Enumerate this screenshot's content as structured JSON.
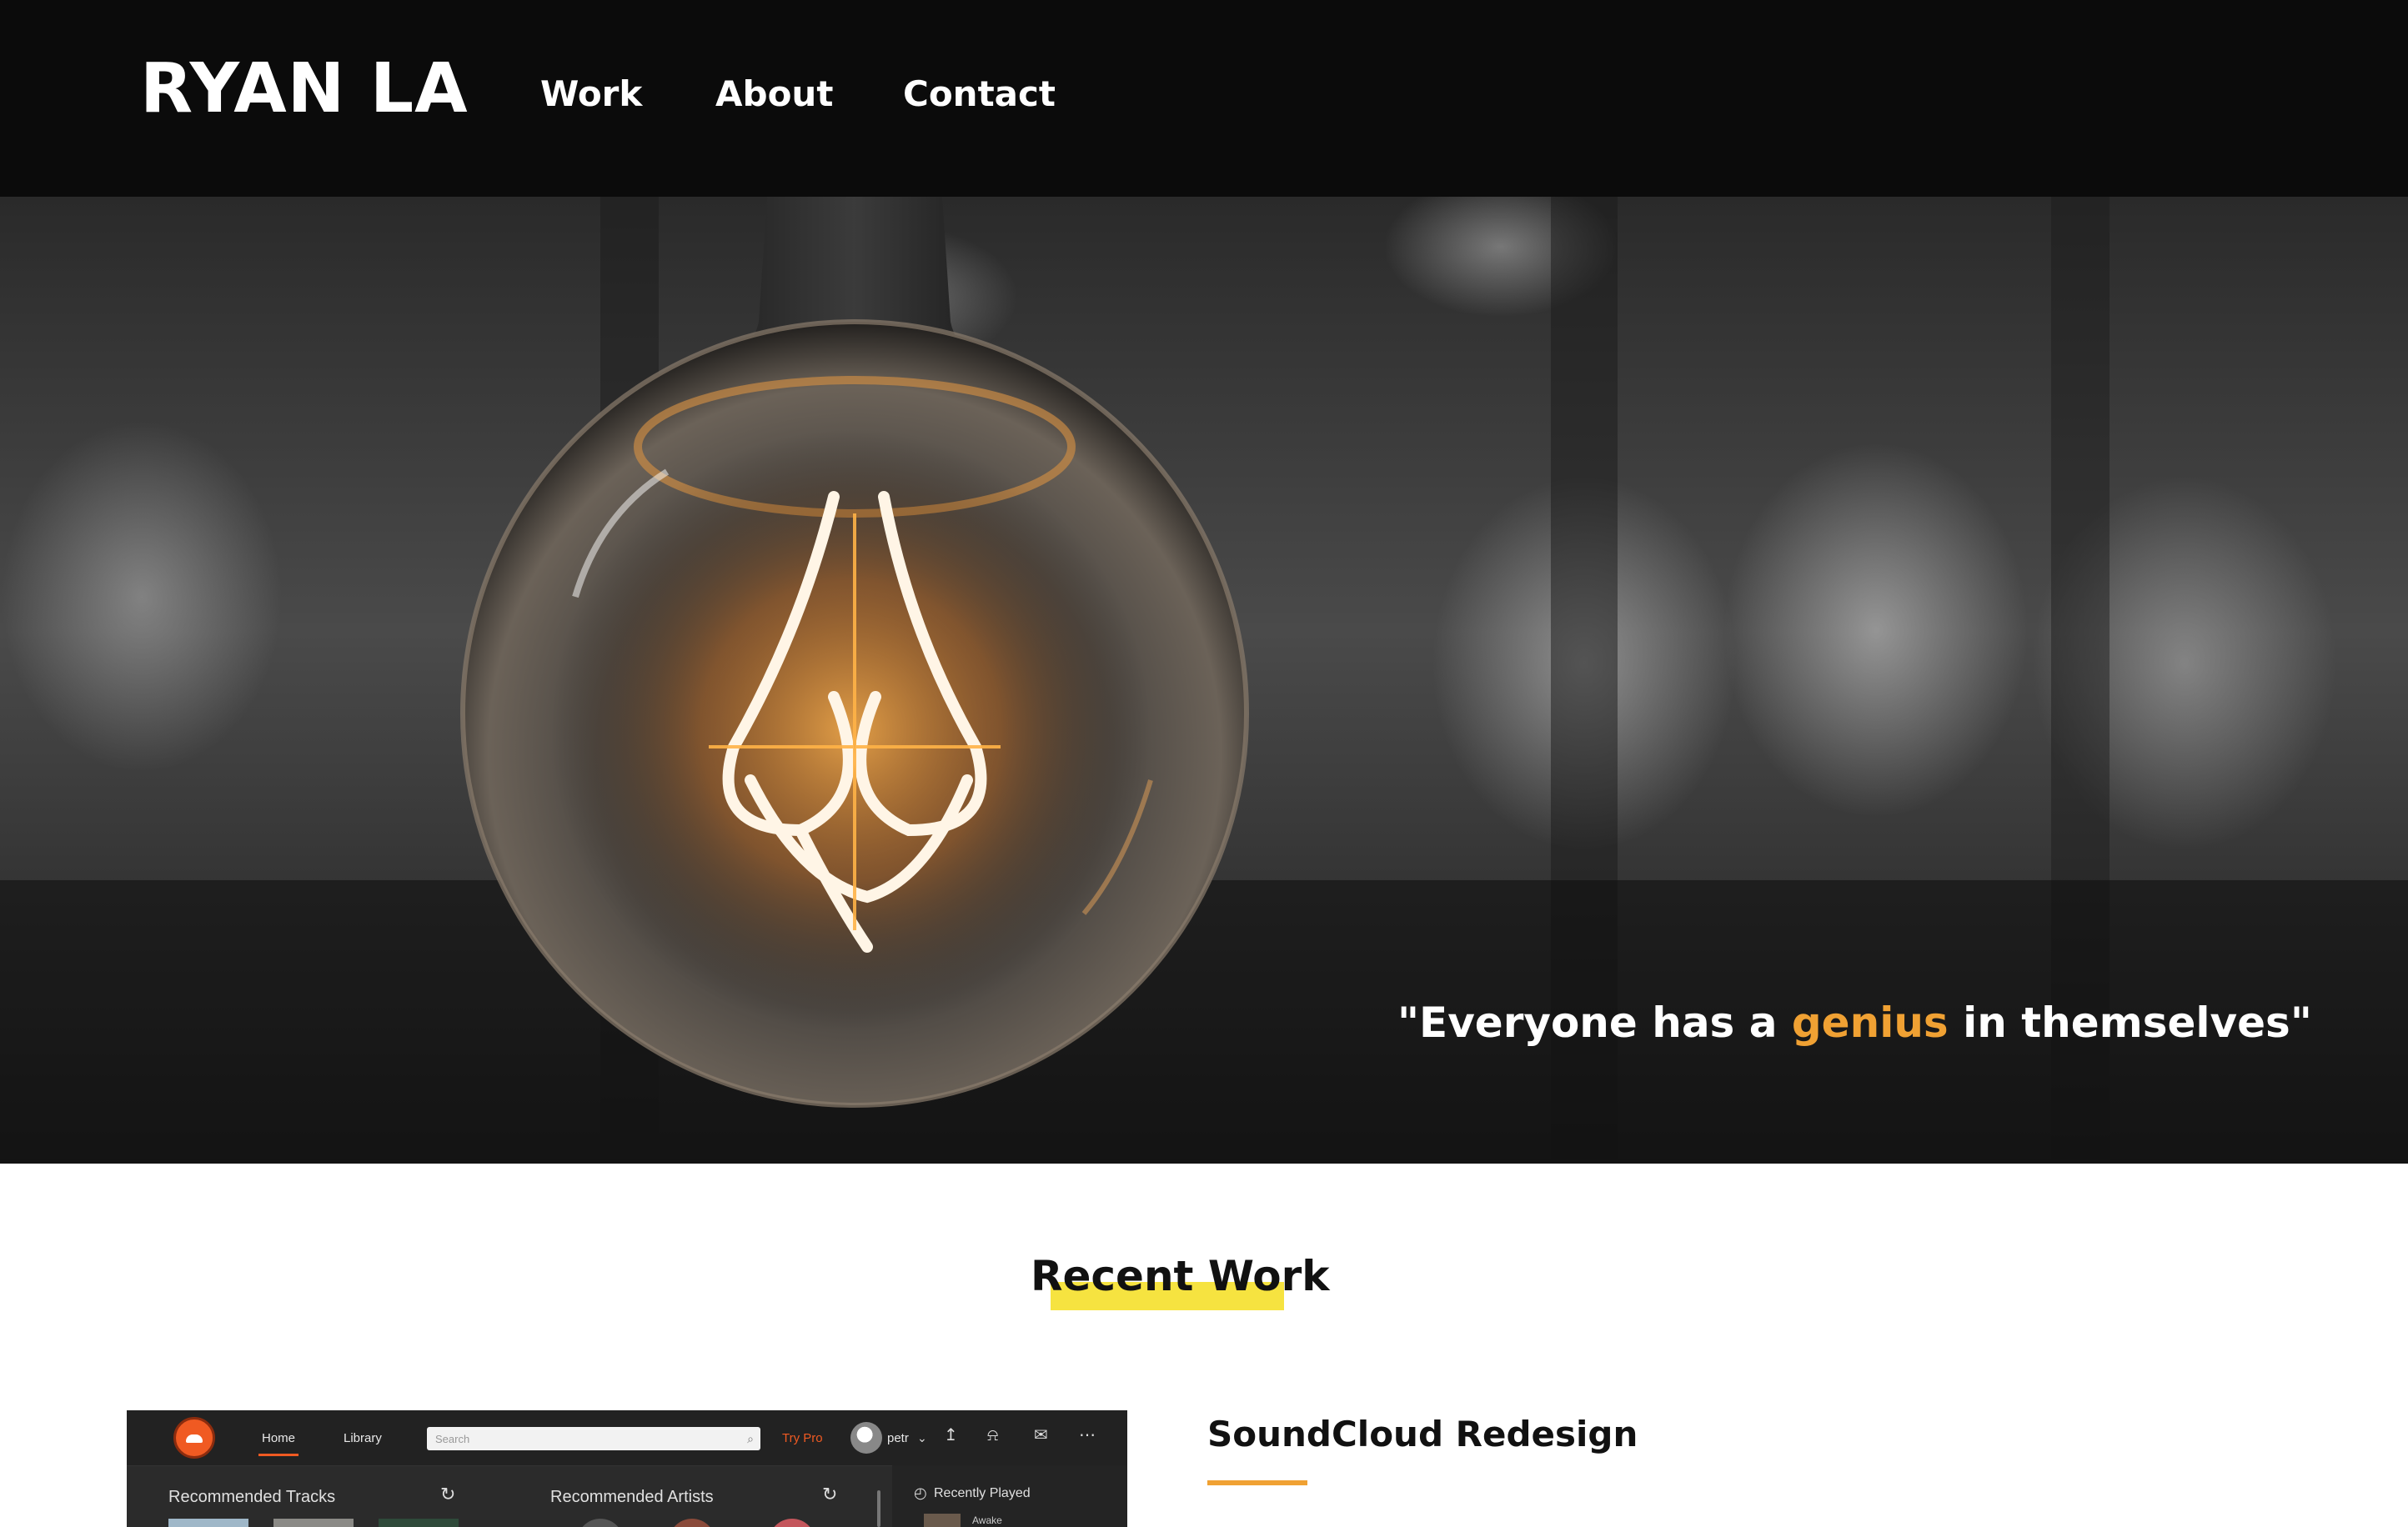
{
  "header": {
    "brand": "RYAN LA",
    "nav": [
      {
        "label": "Work"
      },
      {
        "label": "About"
      },
      {
        "label": "Contact"
      }
    ]
  },
  "hero": {
    "quote_prefix": "\"Everyone has a ",
    "quote_accent": "genius",
    "quote_suffix": " in themselves\"",
    "accent_color": "#f0a133"
  },
  "recent_work": {
    "title": "Recent Work",
    "highlight_color": "#f6e340",
    "projects": [
      {
        "title": "SoundCloud Redesign",
        "underline_color": "#f0a133",
        "thumbnail": {
          "nav_home": "Home",
          "nav_library": "Library",
          "search_placeholder": "Search",
          "try_pro": "Try Pro",
          "username": "petr",
          "col_tracks": "Recommended Tracks",
          "col_artists": "Recommended Artists",
          "recently_played": "Recently Played",
          "recent_item": "Awake",
          "brand_color": "#f05a22"
        }
      }
    ]
  }
}
